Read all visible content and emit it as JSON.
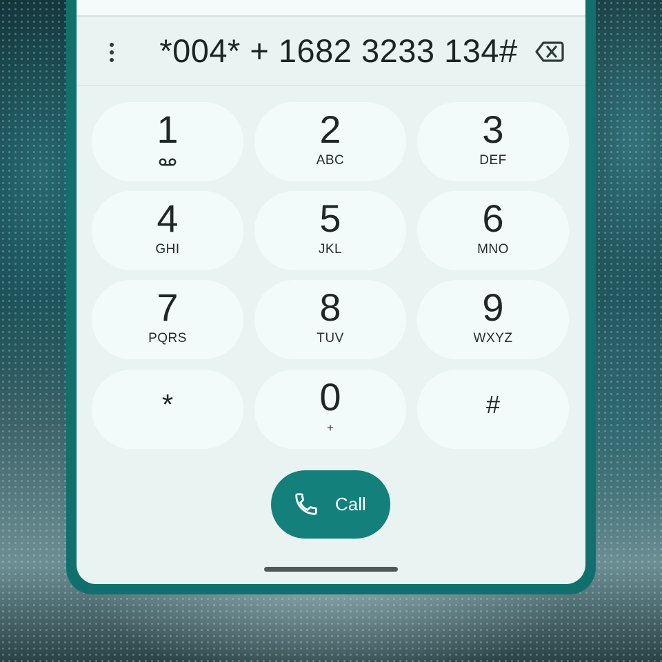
{
  "dialer": {
    "number": "*004* + 1682 3233 134#",
    "call_label": "Call",
    "more_icon": "more-vertical-icon",
    "backspace_icon": "backspace-icon",
    "call_icon": "phone-icon",
    "voicemail_icon": "voicemail-icon"
  },
  "keys": [
    {
      "digit": "1",
      "letters": ""
    },
    {
      "digit": "2",
      "letters": "ABC"
    },
    {
      "digit": "3",
      "letters": "DEF"
    },
    {
      "digit": "4",
      "letters": "GHI"
    },
    {
      "digit": "5",
      "letters": "JKL"
    },
    {
      "digit": "6",
      "letters": "MNO"
    },
    {
      "digit": "7",
      "letters": "PQRS"
    },
    {
      "digit": "8",
      "letters": "TUV"
    },
    {
      "digit": "9",
      "letters": "WXYZ"
    },
    {
      "digit": "*",
      "letters": ""
    },
    {
      "digit": "0",
      "letters": "+"
    },
    {
      "digit": "#",
      "letters": ""
    }
  ],
  "colors": {
    "accent": "#13807c",
    "frame": "#11706e",
    "surface": "#e9f3f2",
    "key": "#f3fbfa"
  }
}
